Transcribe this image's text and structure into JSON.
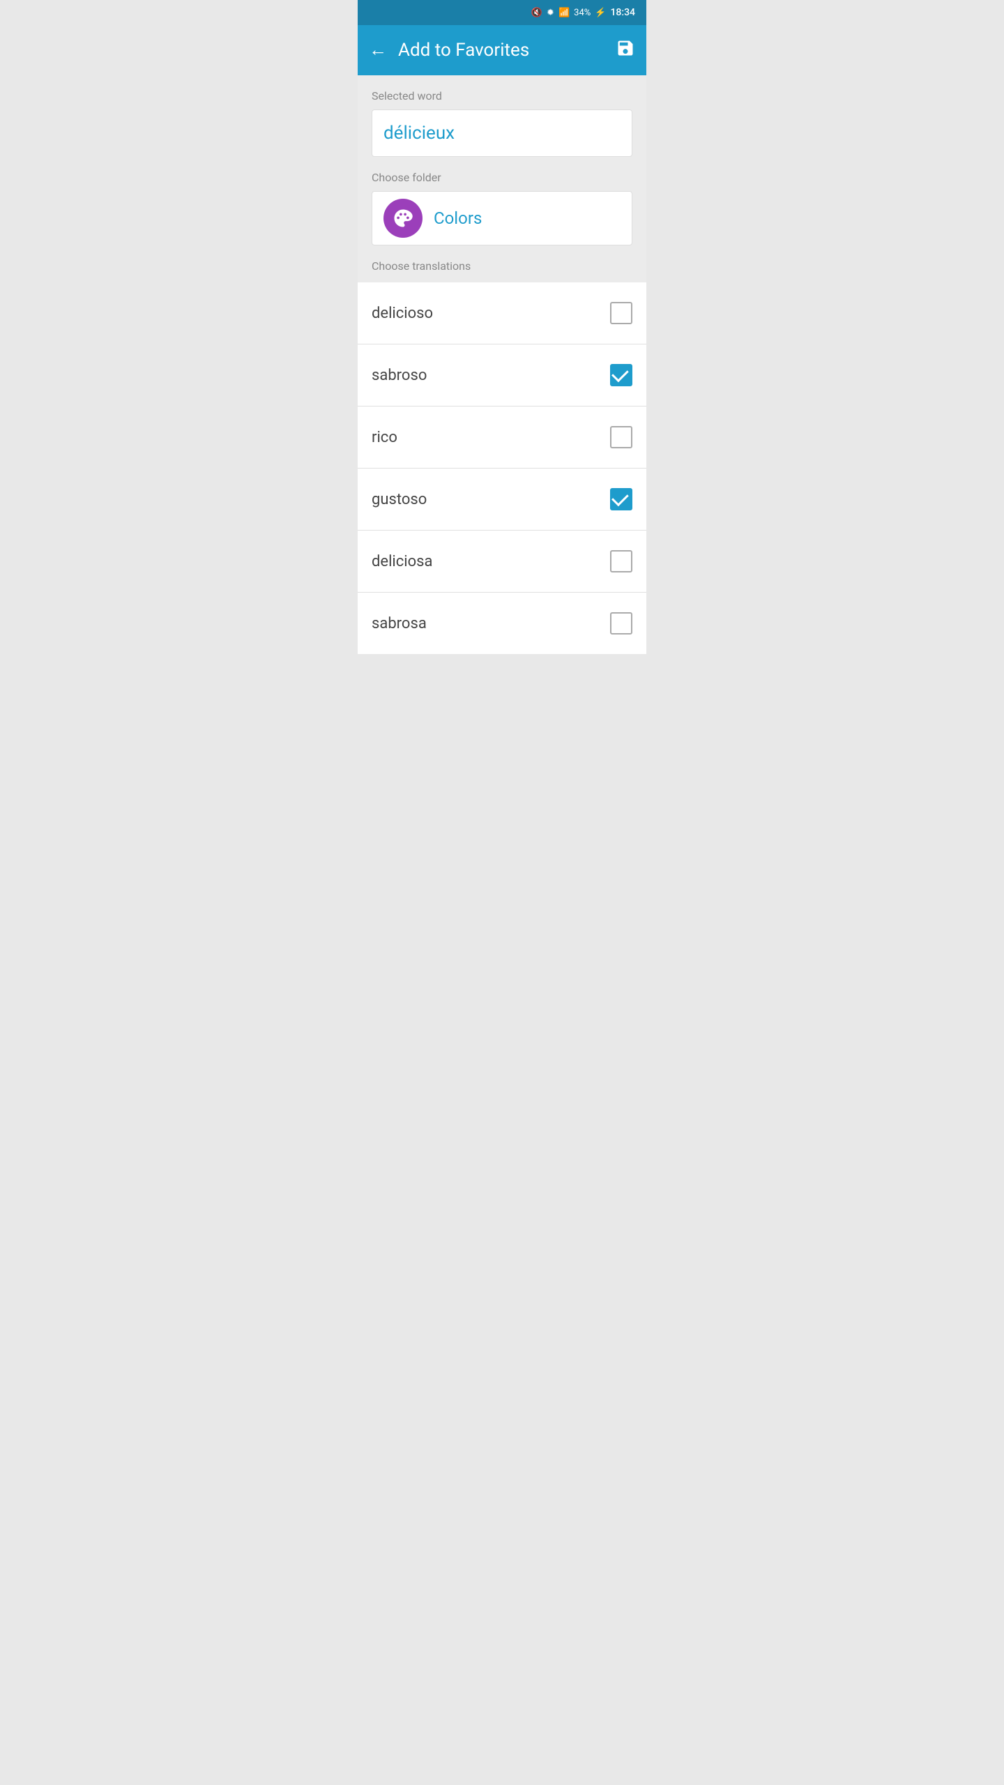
{
  "statusBar": {
    "battery": "34%",
    "time": "18:34"
  },
  "appBar": {
    "title": "Add to Favorites",
    "backLabel": "←",
    "saveIconLabel": "💾"
  },
  "selectedWordSection": {
    "label": "Selected word",
    "word": "délicieux"
  },
  "chooseFolderSection": {
    "label": "Choose folder",
    "folderName": "Colors"
  },
  "chooseTranslationsSection": {
    "label": "Choose translations",
    "translations": [
      {
        "id": 1,
        "text": "delicioso",
        "checked": false
      },
      {
        "id": 2,
        "text": "sabroso",
        "checked": true
      },
      {
        "id": 3,
        "text": "rico",
        "checked": false
      },
      {
        "id": 4,
        "text": "gustoso",
        "checked": true
      },
      {
        "id": 5,
        "text": "deliciosa",
        "checked": false
      },
      {
        "id": 6,
        "text": "sabrosa",
        "checked": false
      }
    ]
  }
}
